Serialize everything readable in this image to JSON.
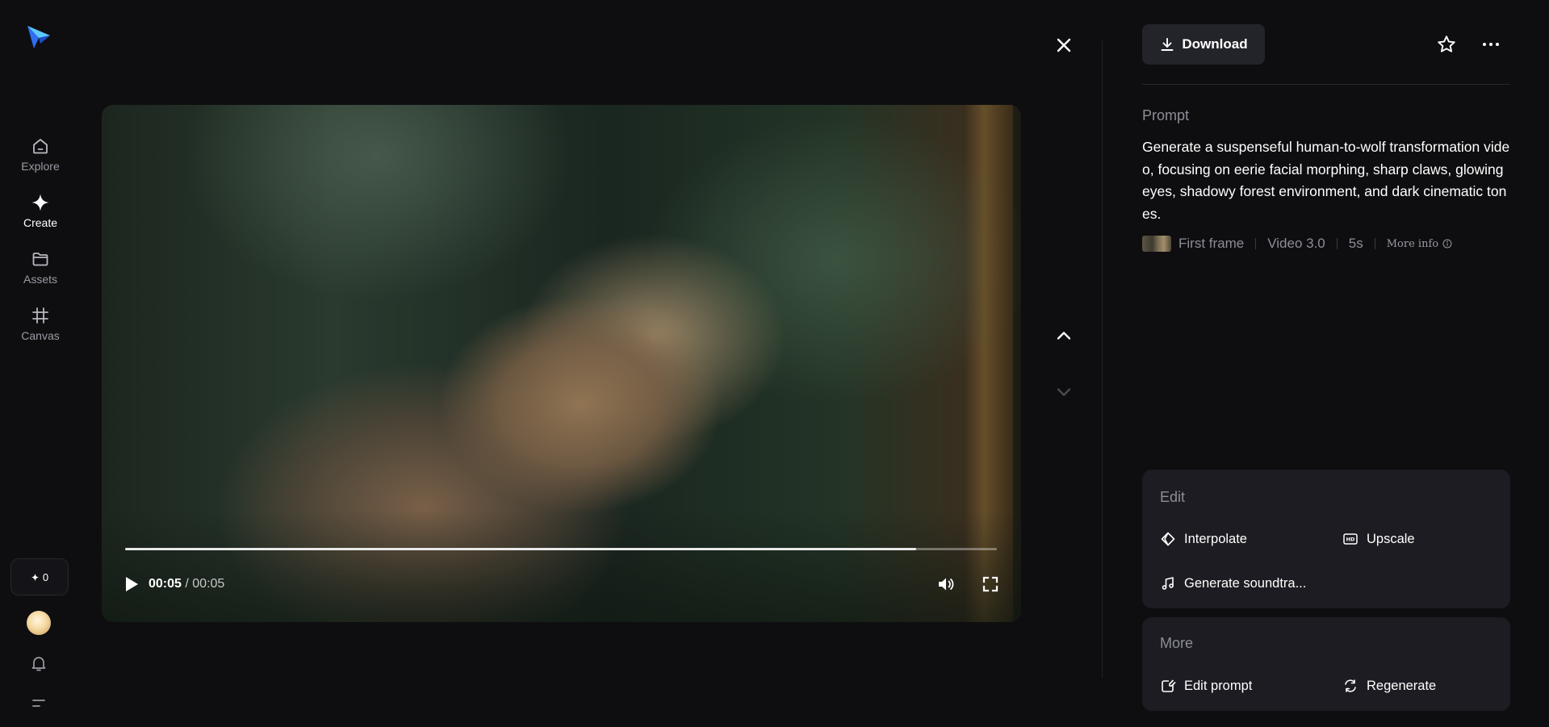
{
  "sidebar": {
    "items": [
      {
        "label": "Explore",
        "icon": "home-icon"
      },
      {
        "label": "Create",
        "icon": "sparkle-icon",
        "active": true
      },
      {
        "label": "Assets",
        "icon": "folder-icon"
      },
      {
        "label": "Canvas",
        "icon": "crop-icon"
      }
    ],
    "credits": "0"
  },
  "player": {
    "current_time": "00:05",
    "separator": "/",
    "total_time": "00:05",
    "progress": 0.907
  },
  "header": {
    "download_label": "Download"
  },
  "prompt": {
    "heading": "Prompt",
    "text": "Generate a suspenseful human-to-wolf transformation video, focusing on eerie facial morphing, sharp claws, glowing eyes, shadowy forest environment, and dark cinematic tones.",
    "first_frame": "First frame",
    "model": "Video 3.0",
    "duration": "5s",
    "more_info": "More info"
  },
  "edit": {
    "heading": "Edit",
    "interpolate": "Interpolate",
    "upscale": "Upscale",
    "soundtrack": "Generate soundtra..."
  },
  "more": {
    "heading": "More",
    "edit_prompt": "Edit prompt",
    "regenerate": "Regenerate"
  },
  "colors": {
    "background": "#0e0e11",
    "card": "#1c1c22",
    "button": "#23232a",
    "muted_text": "#8d8d96",
    "logo_blue": "#2f8cf0"
  }
}
